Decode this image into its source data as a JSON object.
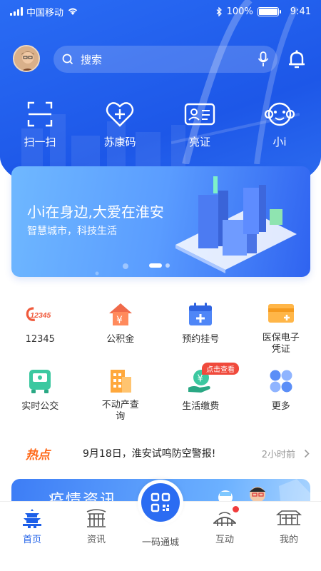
{
  "status": {
    "carrier": "中国移动",
    "battery": "100%",
    "battery_level": 1.0,
    "time": "9:41"
  },
  "header": {
    "search_placeholder": "搜索"
  },
  "quick_actions": [
    {
      "label": "扫一扫",
      "icon": "scan-icon"
    },
    {
      "label": "苏康码",
      "icon": "health-code-icon"
    },
    {
      "label": "亮证",
      "icon": "id-card-icon"
    },
    {
      "label": "小i",
      "icon": "assistant-icon"
    }
  ],
  "banner": {
    "title": "小i在身边,大爱在淮安",
    "subtitle": "智慧城市，科技生活"
  },
  "services": [
    {
      "label": "12345",
      "icon": "hotline-12345-icon"
    },
    {
      "label": "公积金",
      "icon": "housing-fund-icon"
    },
    {
      "label": "预约挂号",
      "icon": "appointment-icon"
    },
    {
      "label": "医保电子凭证",
      "icon": "medical-insurance-icon"
    },
    {
      "label": "实时公交",
      "icon": "bus-icon"
    },
    {
      "label": "不动产查询",
      "icon": "real-estate-icon"
    },
    {
      "label": "生活缴费",
      "icon": "payment-icon",
      "badge": "点击查看"
    },
    {
      "label": "更多",
      "icon": "more-icon"
    }
  ],
  "hot": {
    "tag": "热点",
    "headline": "9月18日，淮安试鸣防空警报!",
    "time": "2小时前"
  },
  "card": {
    "title": "疫情资讯"
  },
  "tabs": [
    {
      "label": "首页",
      "icon": "home-icon"
    },
    {
      "label": "资讯",
      "icon": "news-icon"
    },
    {
      "label": "一码通城",
      "icon": "qr-code-icon"
    },
    {
      "label": "互动",
      "icon": "interact-icon"
    },
    {
      "label": "我的",
      "icon": "profile-icon"
    }
  ],
  "colors": {
    "primary": "#1d5fe8",
    "hot": "#ff6a1a",
    "badge": "#f04a3c"
  }
}
